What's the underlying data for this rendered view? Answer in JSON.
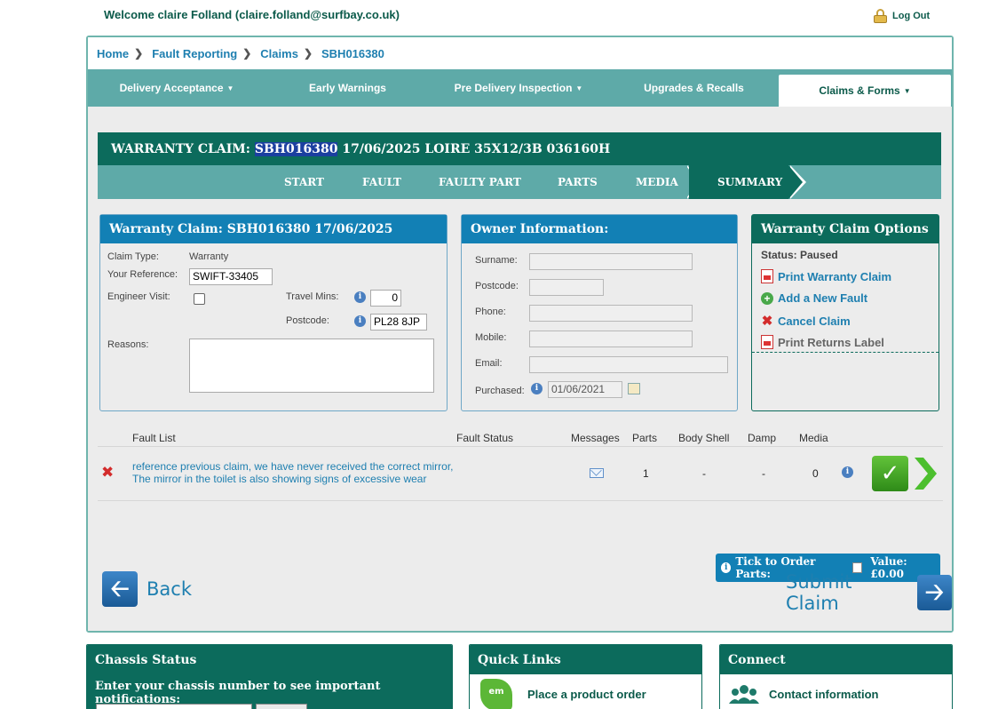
{
  "header": {
    "welcome": "Welcome claire Folland (claire.folland@surfbay.co.uk)",
    "logout": "Log Out"
  },
  "breadcrumb": [
    "Home",
    "Fault Reporting",
    "Claims",
    "SBH016380"
  ],
  "nav": {
    "tabs": [
      {
        "label": "Delivery Acceptance",
        "dropdown": true
      },
      {
        "label": "Early Warnings",
        "dropdown": false
      },
      {
        "label": "Pre Delivery Inspection",
        "dropdown": true
      },
      {
        "label": "Upgrades & Recalls",
        "dropdown": false
      },
      {
        "label": "Claims & Forms",
        "dropdown": true,
        "active": true
      }
    ]
  },
  "claim": {
    "header_prefix": "WARRANTY CLAIM: ",
    "header_id": "SBH016380",
    "header_suffix": " 17/06/2025 LOIRE 35X12/3B 036160H",
    "steps": [
      "START",
      "FAULT",
      "FAULTY PART",
      "PARTS",
      "MEDIA",
      "SUMMARY"
    ],
    "active_step": "SUMMARY"
  },
  "warranty_box": {
    "title": "Warranty Claim: SBH016380 17/06/2025",
    "claim_type_label": "Claim Type:",
    "claim_type_value": "Warranty",
    "your_reference_label": "Your Reference:",
    "your_reference_value": "SWIFT-33405",
    "engineer_visit_label": "Engineer Visit:",
    "travel_mins_label": "Travel Mins:",
    "travel_mins_value": "0",
    "postcode_label": "Postcode:",
    "postcode_value": "PL28 8JP",
    "reasons_label": "Reasons:"
  },
  "owner_box": {
    "title": "Owner Information:",
    "surname_label": "Surname:",
    "postcode_label": "Postcode:",
    "phone_label": "Phone:",
    "mobile_label": "Mobile:",
    "email_label": "Email:",
    "purchased_label": "Purchased:",
    "purchased_value": "01/06/2021"
  },
  "options_box": {
    "title": "Warranty Claim Options",
    "status": "Status: Paused",
    "print_claim": "Print Warranty Claim",
    "add_fault": "Add a New Fault",
    "cancel_claim": "Cancel Claim",
    "print_returns": "Print Returns Label"
  },
  "fault_list": {
    "headers": {
      "fault_list": "Fault List",
      "fault_status": "Fault Status",
      "messages": "Messages",
      "parts": "Parts",
      "body_shell": "Body Shell",
      "damp": "Damp",
      "media": "Media"
    },
    "rows": [
      {
        "description": "reference previous claim, we have never received the correct mirror,\nThe mirror in the toilet is also showing signs of excessive wear",
        "fault_status": "",
        "parts": "1",
        "body_shell": "-",
        "damp": "-",
        "media": "0"
      }
    ]
  },
  "order": {
    "tick_label": "Tick to Order Parts:",
    "value_label": "Value: £0.00"
  },
  "actions": {
    "back": "Back",
    "submit": "Submit Claim"
  },
  "footer": {
    "chassis_title": "Chassis Status",
    "chassis_text": "Enter your chassis number to see important notifications:",
    "quick_links_title": "Quick Links",
    "quick_link_1": "Place a product order",
    "connect_title": "Connect",
    "connect_link_1": "Contact information"
  }
}
